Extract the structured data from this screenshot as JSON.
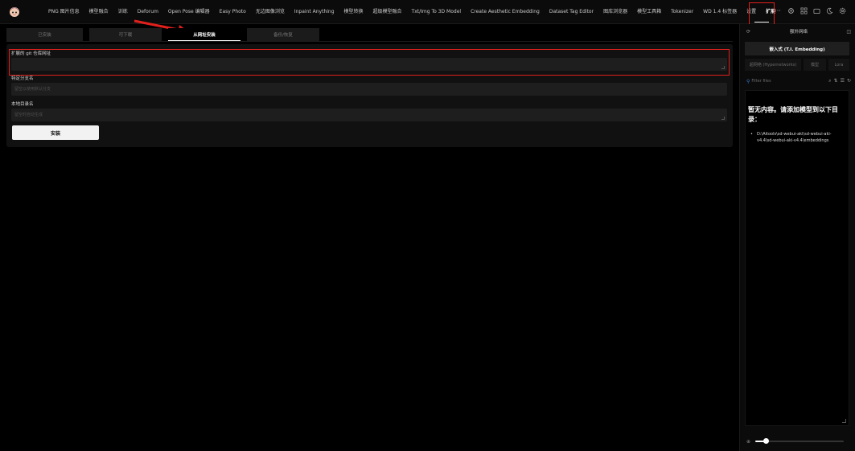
{
  "topbar": {
    "tabs": [
      "PNG 图片信息",
      "模型融合",
      "训练",
      "Deforum",
      "Open Pose 编辑器",
      "Easy Photo",
      "无边图像浏览",
      "Inpaint Anything",
      "模型转换",
      "超级模型融合",
      "Txt/Img To 3D Model",
      "Create Aesthetic Embedding",
      "Dataset Tag Editor",
      "图库浏览器",
      "模型工具箱",
      "Tokenizer",
      "WD 1.4 标签器",
      "设置",
      "扩展"
    ],
    "active_tab": "扩展",
    "more": "···"
  },
  "extensions": {
    "subtabs": [
      "已安装",
      "可下载",
      "从网址安装",
      "备份/恢复"
    ],
    "active_subtab": "从网址安装",
    "url_label": "扩展的 git 仓库网址",
    "url_value": "",
    "branch_label": "特定分支名",
    "branch_placeholder": "留空以使用默认分支",
    "dir_label": "本地目录名",
    "dir_placeholder": "留空时自动生成",
    "install_label": "安装"
  },
  "sidebar": {
    "title": "额外网络",
    "tab_main": "嵌入式 (T.I. Embedding)",
    "tab_hyper": "超网络 (Hypernetworks)",
    "tab_model": "模型",
    "tab_lora": "Lora",
    "filter_placeholder": "Filter files",
    "empty_title": "暂无内容。请添加模型到以下目录：",
    "empty_path": "D:\\Aitools\\sd-webui-aki\\sd-webui-aki-v4.4\\sd-webui-aki-v4.4\\embeddings",
    "zoom_value": 0.12
  },
  "colors": {
    "highlight": "#e0201c",
    "accent": "#3d7bd6"
  }
}
